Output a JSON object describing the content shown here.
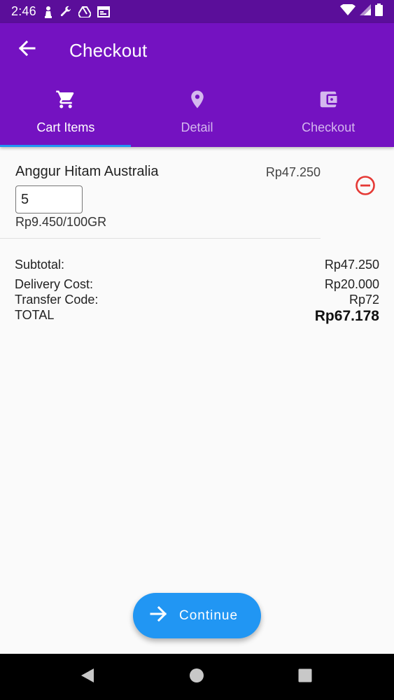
{
  "status_bar": {
    "time": "2:46",
    "left_icons": [
      "chess-pawn-icon",
      "wrench-icon",
      "drive-icon",
      "calendar-icon"
    ],
    "right_icons": [
      "wifi-icon",
      "signal-icon",
      "battery-icon"
    ]
  },
  "app_bar": {
    "title": "Checkout",
    "back_icon": "arrow-back-icon",
    "color": "#7412c1"
  },
  "tabs": [
    {
      "label": "Cart Items",
      "icon": "cart-icon",
      "active": true
    },
    {
      "label": "Detail",
      "icon": "location-pin-icon",
      "active": false
    },
    {
      "label": "Checkout",
      "icon": "wallet-icon",
      "active": false
    }
  ],
  "cart_item": {
    "name": "Anggur Hitam Australia",
    "price": "Rp47.250",
    "quantity": "5",
    "unit_price": "Rp9.450/100GR",
    "remove_icon": "remove-circle-icon"
  },
  "summary": {
    "subtotal_label": "Subtotal:",
    "subtotal_value": "Rp47.250",
    "delivery_label": "Delivery Cost:",
    "delivery_value": "Rp20.000",
    "transfer_label": "Transfer Code:",
    "transfer_value": "Rp72",
    "total_label": "TOTAL",
    "total_value": "Rp67.178"
  },
  "continue_button": {
    "label": "Continue",
    "icon": "arrow-forward-icon",
    "color": "#2196f3"
  },
  "nav_bar": {
    "buttons": [
      "back-triangle-icon",
      "home-circle-icon",
      "recents-square-icon"
    ]
  },
  "colors": {
    "status_bar": "#5b0e9a",
    "accent": "#2196f3",
    "remove": "#e53935"
  }
}
